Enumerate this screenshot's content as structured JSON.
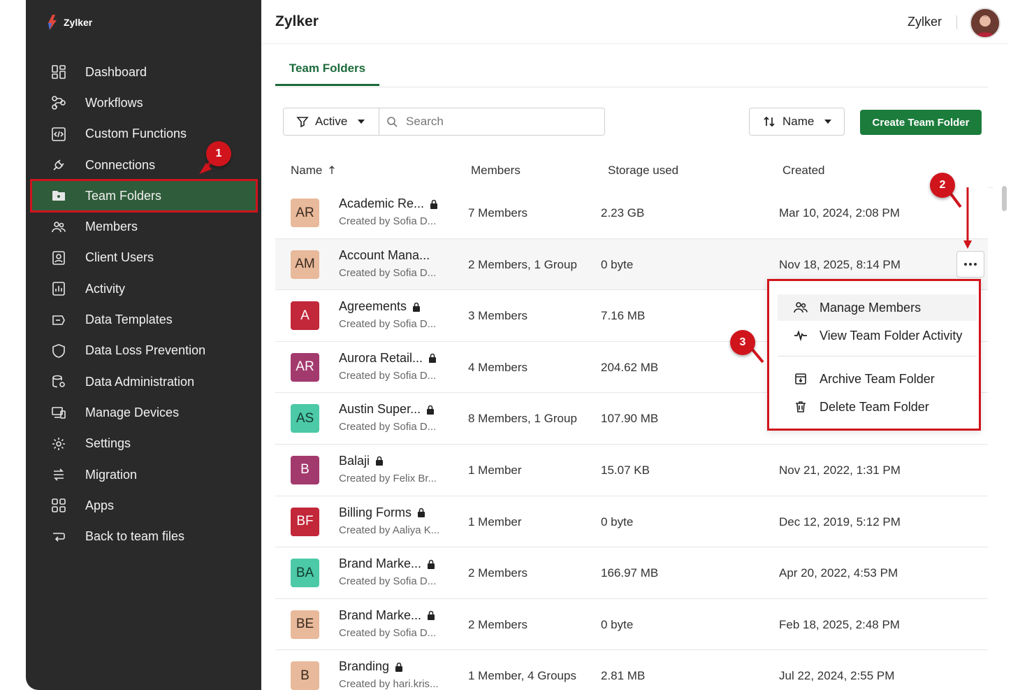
{
  "brand": {
    "name": "Zylker"
  },
  "sidebar": {
    "items": [
      {
        "label": "Dashboard",
        "icon": "dashboard-icon"
      },
      {
        "label": "Workflows",
        "icon": "workflows-icon"
      },
      {
        "label": "Custom Functions",
        "icon": "code-icon"
      },
      {
        "label": "Connections",
        "icon": "plug-icon"
      },
      {
        "label": "Team Folders",
        "icon": "folder-icon",
        "active": true
      },
      {
        "label": "Members",
        "icon": "members-icon"
      },
      {
        "label": "Client Users",
        "icon": "client-user-icon"
      },
      {
        "label": "Activity",
        "icon": "activity-icon"
      },
      {
        "label": "Data Templates",
        "icon": "template-icon"
      },
      {
        "label": "Data Loss Prevention",
        "icon": "shield-icon"
      },
      {
        "label": "Data Administration",
        "icon": "database-gear-icon"
      },
      {
        "label": "Manage Devices",
        "icon": "devices-icon"
      },
      {
        "label": "Settings",
        "icon": "gear-icon"
      },
      {
        "label": "Migration",
        "icon": "migration-icon"
      },
      {
        "label": "Apps",
        "icon": "apps-icon"
      },
      {
        "label": "Back to team files",
        "icon": "back-arrow-icon"
      }
    ]
  },
  "header": {
    "title": "Zylker",
    "user": "Zylker"
  },
  "tabs": [
    {
      "label": "Team Folders",
      "active": true
    }
  ],
  "toolbar": {
    "filter_label": "Active",
    "search_placeholder": "Search",
    "sort_label": "Name",
    "create_label": "Create Team Folder"
  },
  "table": {
    "headers": {
      "name": "Name",
      "members": "Members",
      "storage": "Storage used",
      "created": "Created"
    },
    "rows": [
      {
        "initials": "AR",
        "badge_bg": "#e8b99a",
        "badge_fg": "#3a2a20",
        "name": "Academic Re...",
        "creator": "Created by Sofia D...",
        "members": "7 Members",
        "storage": "2.23 GB",
        "created": "Mar 10, 2024, 2:08 PM",
        "locked": true
      },
      {
        "initials": "AM",
        "badge_bg": "#e8b99a",
        "badge_fg": "#3a2a20",
        "name": "Account Mana...",
        "creator": "Created by Sofia D...",
        "members": "2 Members, 1 Group",
        "storage": "0 byte",
        "created": "Nov 18, 2025, 8:14 PM",
        "locked": false
      },
      {
        "initials": "A",
        "badge_bg": "#c2273a",
        "badge_fg": "#ffffff",
        "name": "Agreements",
        "creator": "Created by Sofia D...",
        "members": "3 Members",
        "storage": "7.16 MB",
        "created": "",
        "locked": true
      },
      {
        "initials": "AR",
        "badge_bg": "#a33a6e",
        "badge_fg": "#ffffff",
        "name": "Aurora Retail...",
        "creator": "Created by Sofia D...",
        "members": "4 Members",
        "storage": "204.62 MB",
        "created": "",
        "locked": true
      },
      {
        "initials": "AS",
        "badge_bg": "#4cc9a6",
        "badge_fg": "#123a30",
        "name": "Austin Super...",
        "creator": "Created by Sofia D...",
        "members": "8 Members, 1 Group",
        "storage": "107.90 MB",
        "created": "",
        "locked": true
      },
      {
        "initials": "B",
        "badge_bg": "#a33a6e",
        "badge_fg": "#ffffff",
        "name": "Balaji",
        "creator": "Created by Felix Br...",
        "members": "1 Member",
        "storage": "15.07 KB",
        "created": "Nov 21, 2022, 1:31 PM",
        "locked": true
      },
      {
        "initials": "BF",
        "badge_bg": "#c2273a",
        "badge_fg": "#ffffff",
        "name": "Billing Forms",
        "creator": "Created by Aaliya K...",
        "members": "1 Member",
        "storage": "0 byte",
        "created": "Dec 12, 2019, 5:12 PM",
        "locked": true
      },
      {
        "initials": "BA",
        "badge_bg": "#4cc9a6",
        "badge_fg": "#123a30",
        "name": "Brand Marke...",
        "creator": "Created by Sofia D...",
        "members": "2 Members",
        "storage": "166.97 MB",
        "created": "Apr 20, 2022, 4:53 PM",
        "locked": true
      },
      {
        "initials": "BE",
        "badge_bg": "#e8b99a",
        "badge_fg": "#3a2a20",
        "name": "Brand Marke...",
        "creator": "Created by Sofia D...",
        "members": "2 Members",
        "storage": "0 byte",
        "created": "Feb 18, 2025, 2:48 PM",
        "locked": true
      },
      {
        "initials": "B",
        "badge_bg": "#e8b99a",
        "badge_fg": "#3a2a20",
        "name": "Branding",
        "creator": "Created by hari.kris...",
        "members": "1 Member, 4 Groups",
        "storage": "2.81 MB",
        "created": "Jul 22, 2024, 2:55 PM",
        "locked": true
      }
    ]
  },
  "context_menu": {
    "items": [
      {
        "label": "Manage Members",
        "icon": "members-icon"
      },
      {
        "label": "View Team Folder Activity",
        "icon": "activity-pulse-icon"
      },
      {
        "label": "Archive Team Folder",
        "icon": "archive-icon"
      },
      {
        "label": "Delete Team Folder",
        "icon": "trash-icon"
      }
    ]
  },
  "callouts": [
    "1",
    "2",
    "3"
  ],
  "colors": {
    "accent": "#1c7c3c",
    "sidebar_bg": "#2a2a2a",
    "highlight": "#d0141c"
  }
}
